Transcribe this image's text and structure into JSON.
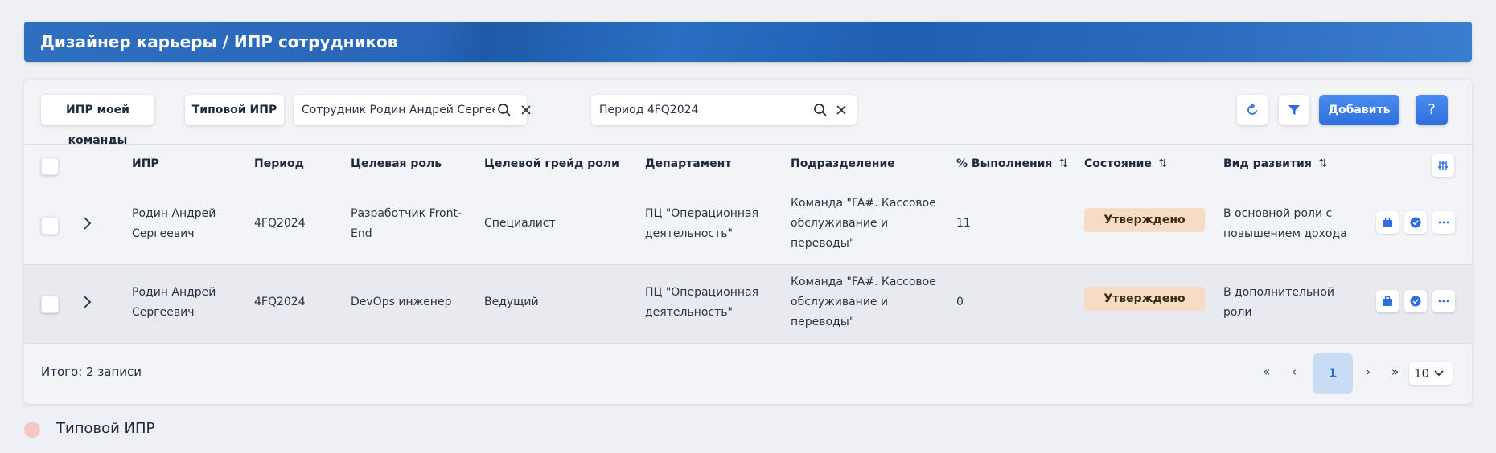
{
  "header": {
    "title": "Дизайнер карьеры / ИПР сотрудников"
  },
  "toolbar": {
    "my_team_label": "ИПР моей команды",
    "typical_label": "Типовой ИПР",
    "employee_filter": "Сотрудник  Родин Андрей Сергее...",
    "period_filter": "Период  4FQ2024",
    "add_label": "Добавить",
    "help_label": "?"
  },
  "table": {
    "columns": [
      "ИПР",
      "Период",
      "Целевая роль",
      "Целевой грейд роли",
      "Департамент",
      "Подразделение",
      "% Выполнения",
      "Состояние",
      "Вид развития"
    ],
    "sort_glyph": "⇅",
    "rows": [
      {
        "name_line1": "Родин Андрей",
        "name_line2": "Сергеевич",
        "period": "4FQ2024",
        "role_line1": "Разработчик Front-",
        "role_line2": "End",
        "grade": "Специалист",
        "dept_line1": "ПЦ \"Операционная",
        "dept_line2": "деятельность\"",
        "unit_line1": "Команда \"FA#. Кассовое",
        "unit_line2": "обслуживание и",
        "unit_line3": "переводы\"",
        "progress": "11",
        "status": "Утверждено",
        "dev_line1": "В основной роли с",
        "dev_line2": "повышением дохода"
      },
      {
        "name_line1": "Родин Андрей",
        "name_line2": "Сергеевич",
        "period": "4FQ2024",
        "role_line1": "DevOps инженер",
        "role_line2": "",
        "grade": "Ведущий",
        "dept_line1": "ПЦ \"Операционная",
        "dept_line2": "деятельность\"",
        "unit_line1": "Команда \"FA#. Кассовое",
        "unit_line2": "обслуживание и",
        "unit_line3": "переводы\"",
        "progress": "0",
        "status": "Утверждено",
        "dev_line1": "В дополнительной",
        "dev_line2": "роли"
      }
    ]
  },
  "footer": {
    "total": "Итого: 2 записи",
    "first": "«",
    "prev": "‹",
    "page": "1",
    "next": "›",
    "last": "»",
    "page_size": "10"
  },
  "legend": {
    "label": "Типовой ИПР",
    "color": "#f5c7c7"
  },
  "colors": {
    "accent": "#2f6fdd",
    "status_bg": "#f6dcc4",
    "header": "#2a66b8"
  }
}
